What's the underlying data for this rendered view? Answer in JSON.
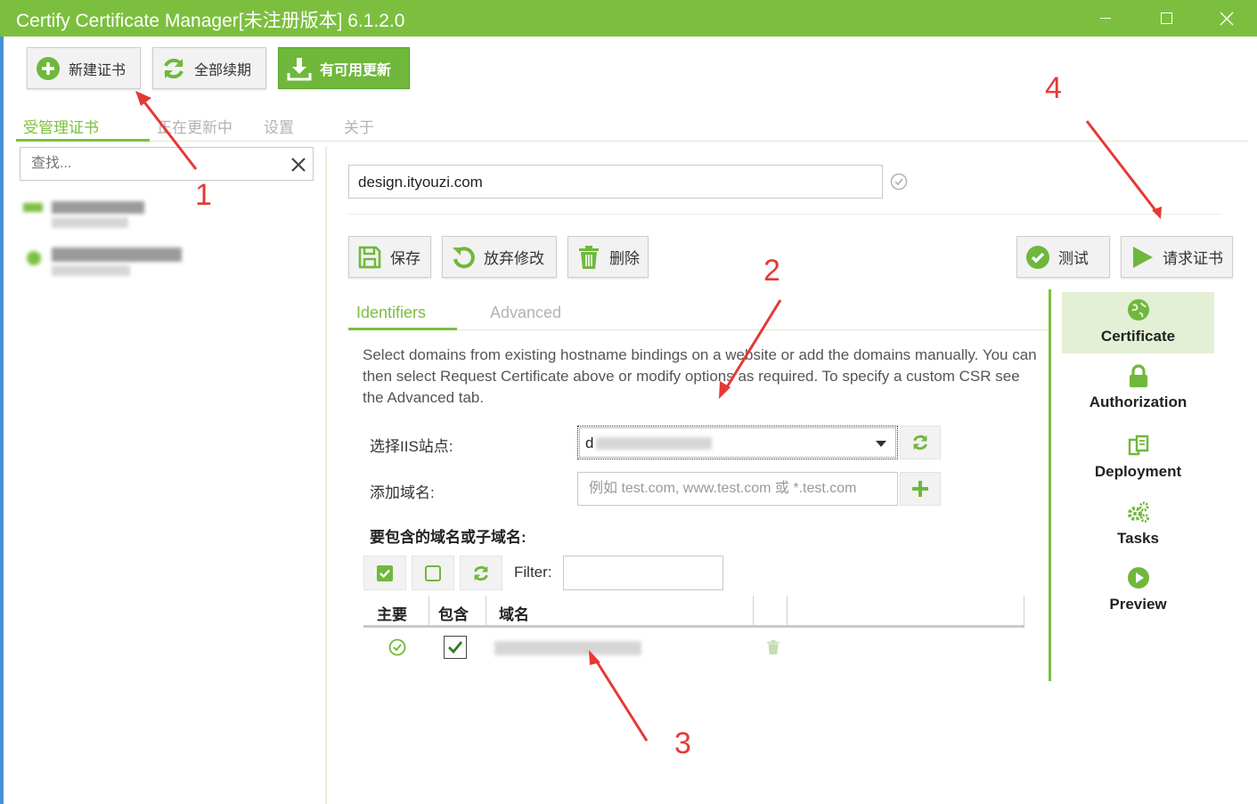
{
  "window": {
    "title": "Certify Certificate Manager[未注册版本] 6.1.2.0",
    "accent": "#7cbf3f"
  },
  "toolbar": {
    "new_cert": "新建证书",
    "renew_all": "全部续期",
    "update_available": "有可用更新"
  },
  "nav": {
    "tabs": [
      "受管理证书",
      "正在更新中",
      "设置",
      "关于"
    ]
  },
  "search": {
    "placeholder": "查找..."
  },
  "detail": {
    "domain_name": "design.ityouzi.com",
    "actions": {
      "save": "保存",
      "discard": "放弃修改",
      "delete": "删除",
      "test": "测试",
      "request": "请求证书"
    },
    "subtabs": [
      "Identifiers",
      "Advanced"
    ],
    "description": "Select domains from existing hostname bindings on a website or add the domains manually. You can then select Request Certificate above or modify options as required. To specify a custom CSR see the Advanced tab.",
    "site_label": "选择IIS站点:",
    "site_value": "d",
    "add_domain_label": "添加域名:",
    "add_domain_placeholder": "例如 test.com, www.test.com 或 *.test.com",
    "included_title": "要包含的域名或子域名:",
    "filter_label": "Filter:",
    "grid_headers": [
      "主要",
      "包含",
      "域名"
    ]
  },
  "rail": {
    "items": [
      "Certificate",
      "Authorization",
      "Deployment",
      "Tasks",
      "Preview"
    ],
    "active": "Certificate"
  },
  "annotations": [
    "1",
    "2",
    "3",
    "4"
  ]
}
